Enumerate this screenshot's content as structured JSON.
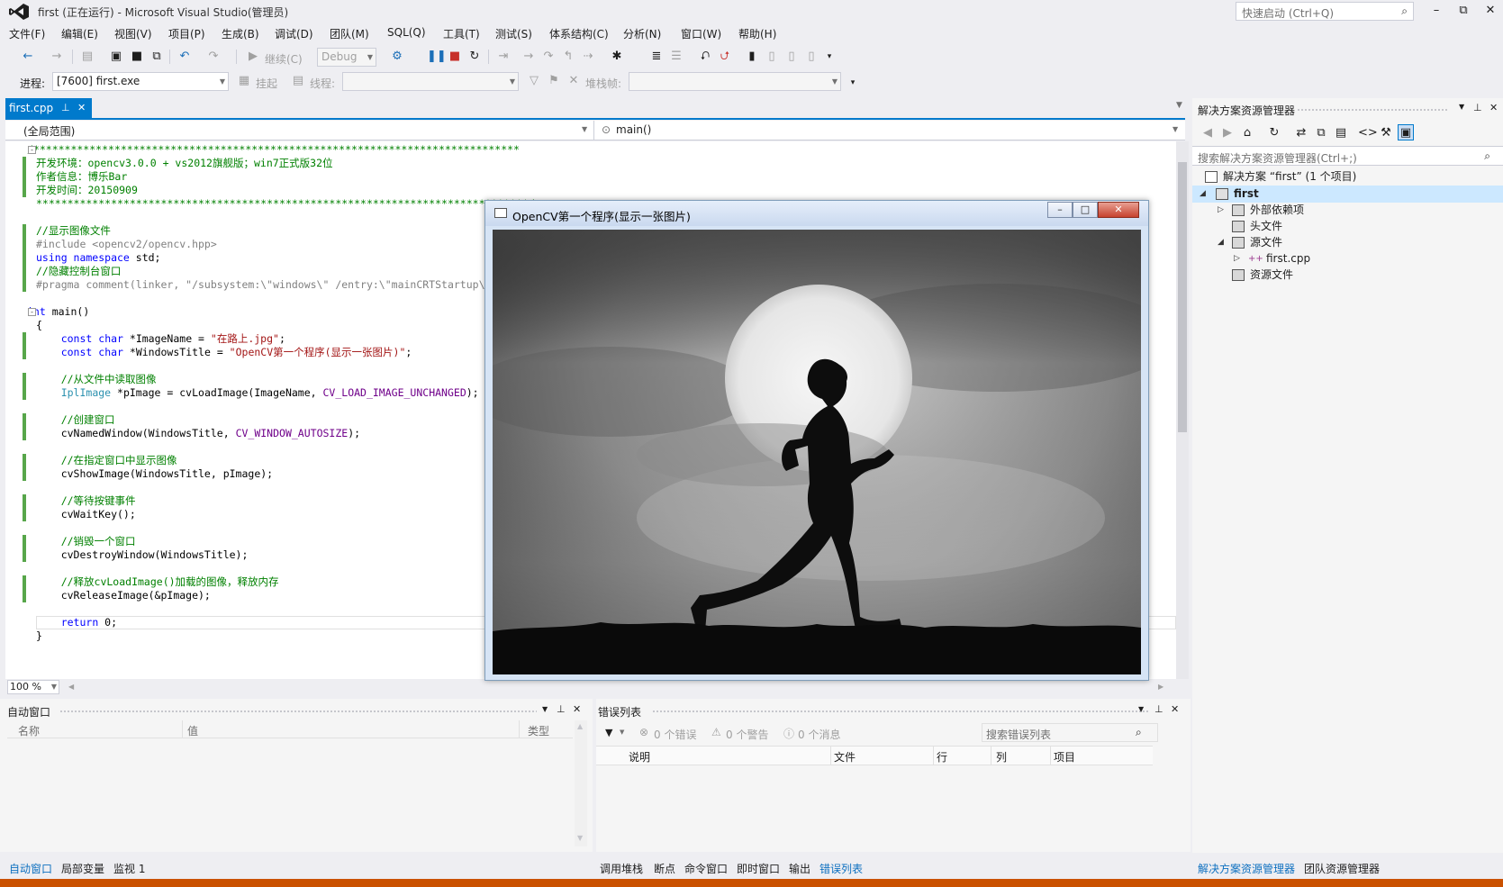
{
  "window": {
    "title": "first (正在运行) - Microsoft Visual Studio(管理员)",
    "quick_launch_placeholder": "快速启动 (Ctrl+Q)"
  },
  "menu": [
    "文件(F)",
    "编辑(E)",
    "视图(V)",
    "项目(P)",
    "生成(B)",
    "调试(D)",
    "团队(M)",
    "SQL(Q)",
    "工具(T)",
    "测试(S)",
    "体系结构(C)",
    "分析(N)",
    "窗口(W)",
    "帮助(H)"
  ],
  "toolbar": {
    "continue_label": "继续(C)",
    "config": "Debug",
    "process_label": "进程:",
    "process_value": "[7600] first.exe",
    "suspend_label": "挂起",
    "thread_label": "线程:",
    "stackframe_label": "堆栈帧:"
  },
  "editor": {
    "tab_name": "first.cpp",
    "scope": "(全局范围)",
    "function": "main()",
    "zoom": "100 %",
    "lines": [
      {
        "t": "/******************************************************************************",
        "c": "cm"
      },
      {
        "t": "开发环境：opencv3.0.0 + vs2012旗舰版；win7正式版32位",
        "c": "cm"
      },
      {
        "t": "作者信息：博乐Bar",
        "c": "cm"
      },
      {
        "t": "开发时间：20150909",
        "c": "cm"
      },
      {
        "t": "*******************************************************************************/",
        "c": "cm"
      },
      {
        "t": "",
        "c": ""
      },
      {
        "t": "//显示图像文件",
        "c": "cm"
      },
      {
        "t": "#include <opencv2/opencv.hpp>",
        "c": "pp"
      },
      {
        "t": "using namespace std;",
        "c": "kw"
      },
      {
        "t": "//隐藏控制台窗口",
        "c": "cm"
      },
      {
        "t": "#pragma comment(linker, \"/subsystem:\\\"windows\\\" /entry:\\\"mainCRTStartup\\\"\")",
        "c": "pp"
      },
      {
        "t": "",
        "c": ""
      },
      {
        "t": "int main()",
        "c": "kw"
      },
      {
        "t": "{",
        "c": ""
      },
      {
        "t": "    const char *ImageName = \"在路上.jpg\";",
        "c": "mix1"
      },
      {
        "t": "    const char *WindowsTitle = \"OpenCV第一个程序(显示一张图片)\";",
        "c": "mix2"
      },
      {
        "t": "",
        "c": ""
      },
      {
        "t": "    //从文件中读取图像",
        "c": "cm"
      },
      {
        "t": "    IplImage *pImage = cvLoadImage(ImageName, CV_LOAD_IMAGE_UNCHANGED);",
        "c": "mix3"
      },
      {
        "t": "",
        "c": ""
      },
      {
        "t": "    //创建窗口",
        "c": "cm"
      },
      {
        "t": "    cvNamedWindow(WindowsTitle, CV_WINDOW_AUTOSIZE);",
        "c": "mix4"
      },
      {
        "t": "",
        "c": ""
      },
      {
        "t": "    //在指定窗口中显示图像",
        "c": "cm"
      },
      {
        "t": "    cvShowImage(WindowsTitle, pImage);",
        "c": ""
      },
      {
        "t": "",
        "c": ""
      },
      {
        "t": "    //等待按键事件",
        "c": "cm"
      },
      {
        "t": "    cvWaitKey();",
        "c": ""
      },
      {
        "t": "",
        "c": ""
      },
      {
        "t": "    //销毁一个窗口",
        "c": "cm"
      },
      {
        "t": "    cvDestroyWindow(WindowsTitle);",
        "c": ""
      },
      {
        "t": "",
        "c": ""
      },
      {
        "t": "    //释放cvLoadImage()加载的图像，释放内存",
        "c": "cm"
      },
      {
        "t": "    cvReleaseImage(&pImage);",
        "c": ""
      },
      {
        "t": "",
        "c": ""
      },
      {
        "t": "    return 0;",
        "c": "mix5"
      },
      {
        "t": "}",
        "c": ""
      }
    ]
  },
  "opencv_window": {
    "title": "OpenCV第一个程序(显示一张图片)"
  },
  "solution_explorer": {
    "title": "解决方案资源管理器",
    "search_placeholder": "搜索解决方案资源管理器(Ctrl+;)",
    "items": [
      "解决方案 “first” (1 个项目)",
      "first",
      "外部依赖项",
      "头文件",
      "源文件",
      "first.cpp",
      "资源文件"
    ]
  },
  "auto_panel": {
    "title": "自动窗口",
    "columns": [
      "名称",
      "值",
      "类型"
    ]
  },
  "error_panel": {
    "title": "错误列表",
    "errors": "0 个错误",
    "warnings": "0 个警告",
    "messages": "0 个消息",
    "search_placeholder": "搜索错误列表",
    "columns": [
      "说明",
      "文件",
      "行",
      "列",
      "项目"
    ]
  },
  "bottom_tabs_left": [
    "自动窗口",
    "局部变量",
    "监视 1"
  ],
  "bottom_tabs_mid": [
    "调用堆栈",
    "断点",
    "命令窗口",
    "即时窗口",
    "输出",
    "错误列表"
  ],
  "bottom_tabs_right": [
    "解决方案资源管理器",
    "团队资源管理器"
  ],
  "colors": {
    "accent": "#007acc",
    "status_bar": "#ca5100",
    "comment": "#008000",
    "keyword": "#0000ff",
    "string": "#a31515"
  }
}
